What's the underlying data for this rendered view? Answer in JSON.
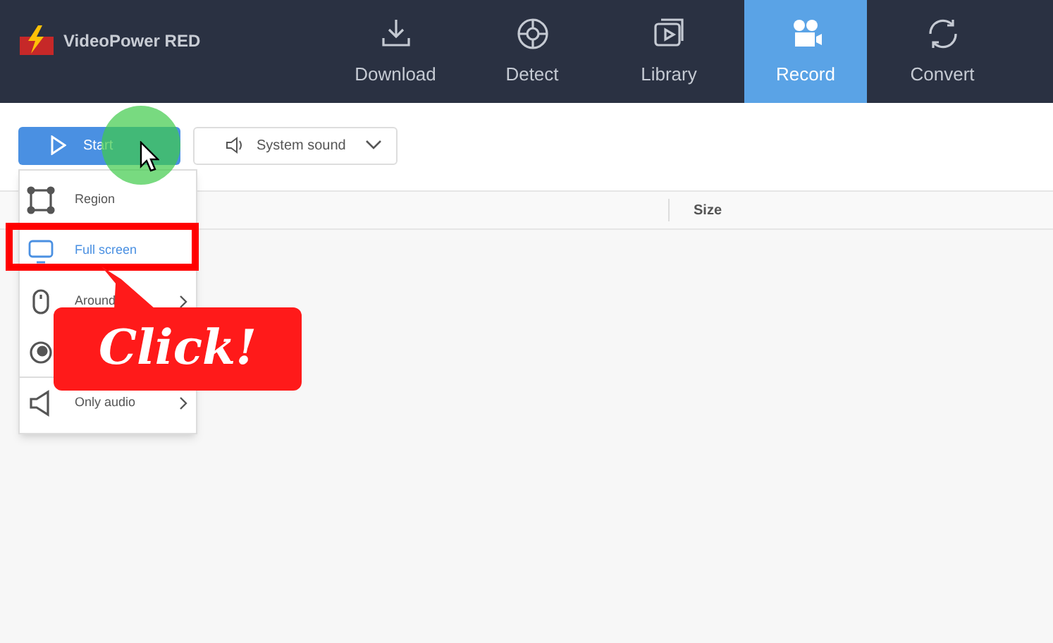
{
  "app": {
    "title": "VideoPower RED"
  },
  "tabs": [
    {
      "label": "Download",
      "kind": "download",
      "selected": false
    },
    {
      "label": "Detect",
      "kind": "detect",
      "selected": false
    },
    {
      "label": "Library",
      "kind": "library",
      "selected": false
    },
    {
      "label": "Record",
      "kind": "record",
      "selected": true
    },
    {
      "label": "Convert",
      "kind": "convert",
      "selected": false
    }
  ],
  "toolbar": {
    "start_button": "Start",
    "audio_dropdown": "System sound"
  },
  "table": {
    "columns": [
      "Size"
    ]
  },
  "menu": {
    "items": [
      {
        "label": "Region",
        "kind": "region",
        "submenu": false,
        "selected": false
      },
      {
        "label": "Full screen",
        "kind": "screen",
        "submenu": false,
        "selected": true
      },
      {
        "label": "Around",
        "kind": "mouse",
        "submenu": true,
        "selected": false
      },
      {
        "kind": "webcam",
        "selected": false
      },
      {
        "label": "Only audio",
        "kind": "speaker",
        "submenu": true,
        "selected": false
      }
    ]
  },
  "callout": {
    "text": "Click!"
  }
}
